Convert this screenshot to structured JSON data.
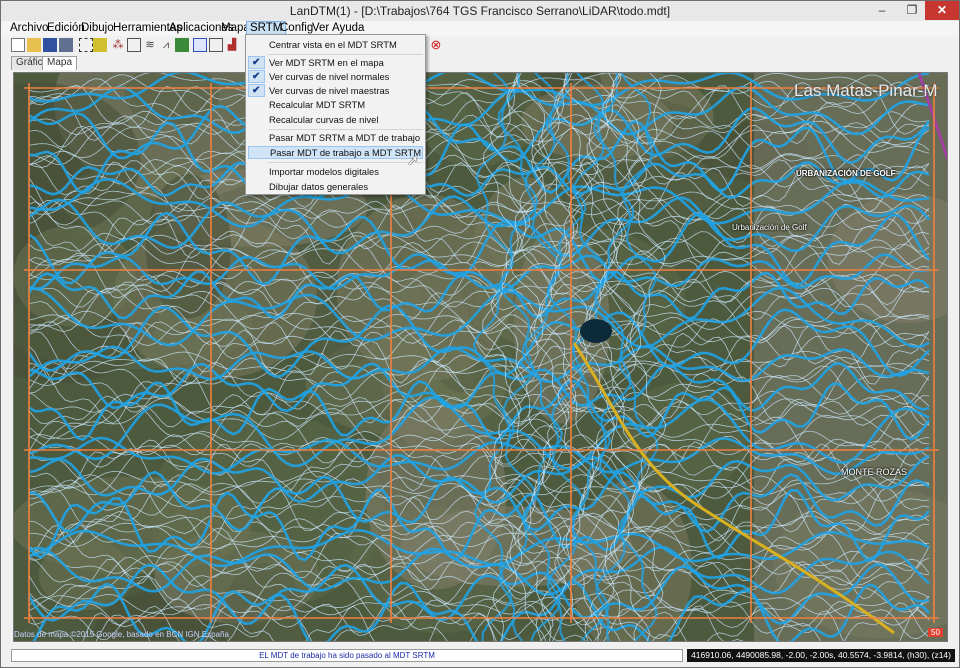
{
  "window": {
    "title": "LanDTM(1) - [D:\\Trabajos\\764 TGS Francisco Serrano\\LiDAR\\todo.mdt]",
    "minimize": "–",
    "maximize": "❐",
    "close": "✕"
  },
  "menubar": {
    "items": [
      "Archivo",
      "Edición",
      "Dibujo",
      "Herramientas",
      "Aplicaciones",
      "Mapa",
      "SRTM",
      "Config",
      "Ver",
      "Ayuda"
    ],
    "active": "SRTM"
  },
  "tabs": [
    "Gráfico",
    "Mapa"
  ],
  "selected_tab": "Mapa",
  "srtm_menu": {
    "items": [
      {
        "label": "Centrar vista en el MDT SRTM",
        "checked": false
      },
      {
        "label": "Ver MDT SRTM en el mapa",
        "checked": true
      },
      {
        "label": "Ver curvas de nivel normales",
        "checked": true
      },
      {
        "label": "Ver curvas de nivel maestras",
        "checked": true
      },
      {
        "label": "Recalcular MDT SRTM",
        "checked": false
      },
      {
        "label": "Recalcular curvas de nivel",
        "checked": false
      },
      {
        "label": "Pasar MDT SRTM a MDT de trabajo",
        "checked": false
      },
      {
        "label": "Pasar MDT de trabajo a MDT SRTM",
        "checked": false,
        "hovered": true
      },
      {
        "label": "Importar modelos digitales",
        "checked": false
      },
      {
        "label": "Dibujar datos generales",
        "checked": false
      }
    ],
    "check_glyph": "✔"
  },
  "map": {
    "labels": {
      "place1": "Las Matas-Pinar-M",
      "place2": "URBANIZACIÓN DE GOLF",
      "place3": "Urbanización de Golf",
      "place4": "MONTE ROZAS",
      "credits": "Datos de mapa ©2015 Google, basado en BCN IGN España",
      "scale": "50"
    },
    "colors": {
      "background": "#4e5a3e",
      "contour_normal": "#c9e8ff",
      "contour_master": "#1fa3e6",
      "grid": "#f08040",
      "road_yellow": "#d8b020",
      "road_purple": "#a040a0"
    }
  },
  "status": {
    "message": "EL MDT de trabajo ha sido pasado al MDT SRTM",
    "coords": "416910.06, 4490085.98, -2.00, -2.00s, 40.5574, -3.9814, (h30), (z14)"
  }
}
